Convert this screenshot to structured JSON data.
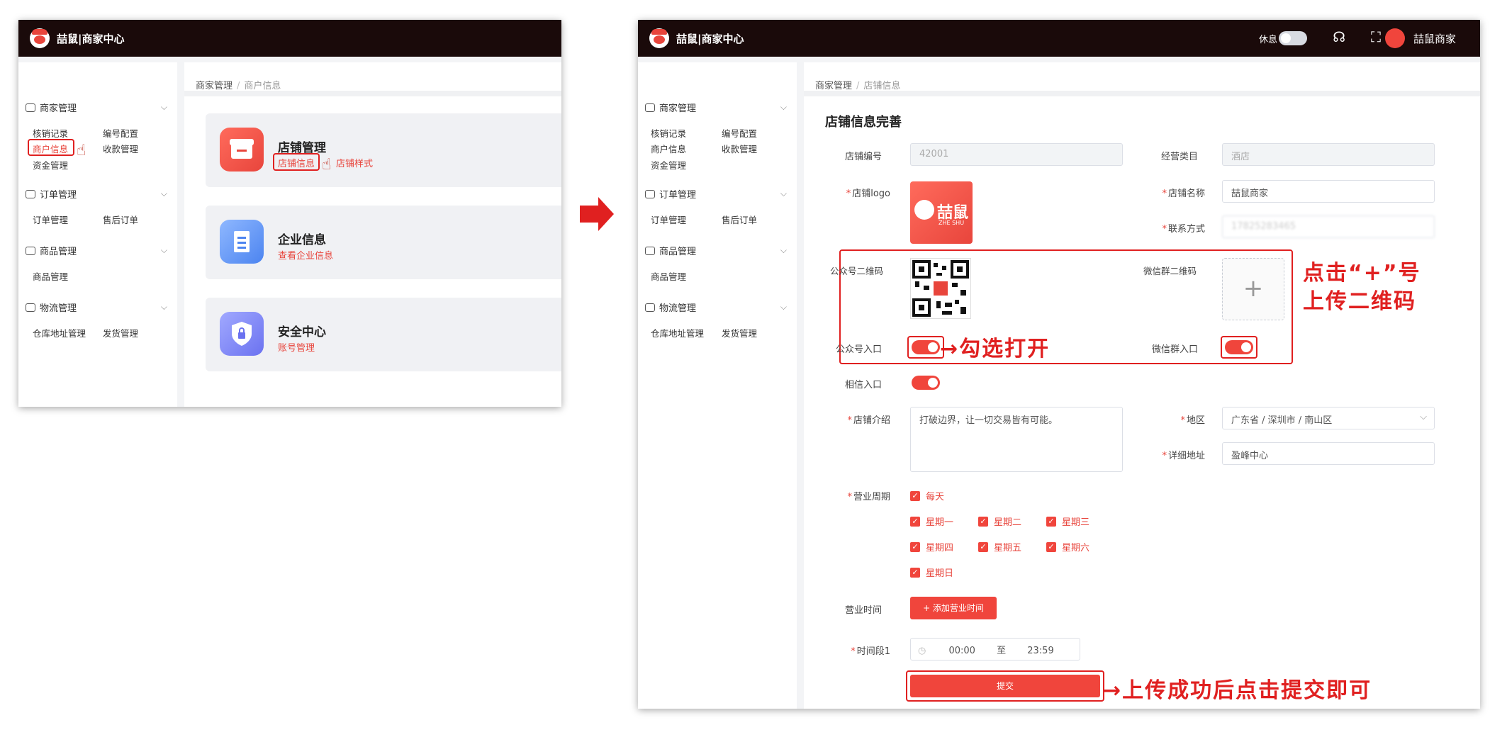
{
  "left": {
    "brand": "喆鼠|商家中心",
    "sidebar": {
      "groups": [
        {
          "label": "商家管理",
          "items": [
            "核销记录",
            "编号配置",
            "商户信息",
            "收款管理",
            "资金管理"
          ]
        },
        {
          "label": "订单管理",
          "items": [
            "订单管理",
            "售后订单"
          ]
        },
        {
          "label": "商品管理",
          "items": [
            "商品管理"
          ]
        },
        {
          "label": "物流管理",
          "items": [
            "仓库地址管理",
            "发货管理"
          ]
        }
      ]
    },
    "breadcrumb": {
      "parent": "商家管理",
      "sep": "/",
      "current": "商户信息"
    },
    "cards": [
      {
        "title": "店铺管理",
        "link": "店铺信息",
        "link2": "店铺样式"
      },
      {
        "title": "企业信息",
        "link": "查看企业信息"
      },
      {
        "title": "安全中心",
        "link": "账号管理"
      }
    ]
  },
  "right": {
    "brand": "喆鼠|商家中心",
    "header": {
      "rest_label": "休息",
      "user_name": "喆鼠商家"
    },
    "sidebar": {
      "groups": [
        {
          "label": "商家管理",
          "items": [
            "核销记录",
            "编号配置",
            "商户信息",
            "收款管理",
            "资金管理"
          ]
        },
        {
          "label": "订单管理",
          "items": [
            "订单管理",
            "售后订单"
          ]
        },
        {
          "label": "商品管理",
          "items": [
            "商品管理"
          ]
        },
        {
          "label": "物流管理",
          "items": [
            "仓库地址管理",
            "发货管理"
          ]
        }
      ]
    },
    "breadcrumb": {
      "parent": "商家管理",
      "sep": "/",
      "current": "店铺信息"
    },
    "form": {
      "title": "店铺信息完善",
      "store_no_label": "店铺编号",
      "store_no_value": "42001",
      "category_label": "经营类目",
      "category_value": "酒店",
      "logo_label": "店铺logo",
      "logo_text": "喆鼠",
      "logo_subtext": "ZHE SHU",
      "store_name_label": "店铺名称",
      "store_name_value": "喆鼠商家",
      "contact_label": "联系方式",
      "contact_value": "17825283465",
      "gzh_qr_label": "公众号二维码",
      "wx_qr_label": "微信群二维码",
      "upload_plus": "+",
      "gzh_entry_label": "公众号入口",
      "wx_entry_label": "微信群入口",
      "album_entry_label": "相信入口",
      "intro_label": "店铺介绍",
      "intro_value": "打破边界，让一切交易皆有可能。",
      "region_label": "地区",
      "region_value": "广东省 / 深圳市 / 南山区",
      "address_label": "详细地址",
      "address_value": "盈峰中心",
      "cycle_label": "营业周期",
      "days": [
        "每天",
        "星期一",
        "星期二",
        "星期三",
        "星期四",
        "星期五",
        "星期六",
        "星期日"
      ],
      "time_label": "营业时间",
      "add_time_btn": "+ 添加营业时间",
      "period_label": "时间段1",
      "time_start": "00:00",
      "time_to": "至",
      "time_end": "23:59",
      "submit": "提交"
    }
  },
  "annotations": {
    "upload_qr": [
      "点击“+”号",
      "上传二维码"
    ],
    "toggle_on": "→勾选打开",
    "submit_hint": "→上传成功后点击提交即可"
  },
  "colors": {
    "accent": "#f0453c",
    "highlight": "#e02020",
    "topbar": "#1a0a0a"
  }
}
